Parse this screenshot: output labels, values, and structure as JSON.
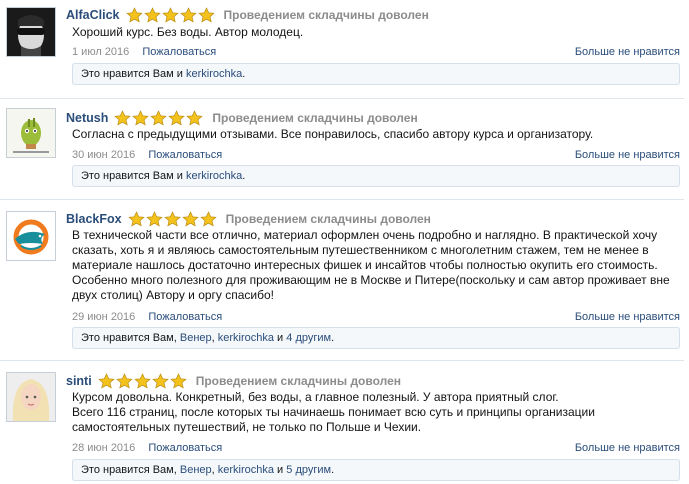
{
  "colors": {
    "link": "#2a4d7a",
    "muted": "#8c8c8c",
    "star": "#f3c21c",
    "like_box_bg": "#f5f8fb"
  },
  "reviews": [
    {
      "author": "AlfaClick",
      "rating": 5,
      "verdict": "Проведением складчины доволен",
      "text": [
        "Хороший курс. Без воды. Автор молодец."
      ],
      "date": "1 июл 2016",
      "report_label": "Пожаловаться",
      "dislike_label": "Больше не нравится",
      "likes": {
        "prefix": "Это нравится Вам и ",
        "users": [
          "kerkirochka"
        ],
        "suffix": "."
      }
    },
    {
      "author": "Netush",
      "rating": 5,
      "verdict": "Проведением складчины доволен",
      "text": [
        "Согласна с предыдущими отзывами. Все понравилось, спасибо автору курса и организатору."
      ],
      "date": "30 июн 2016",
      "report_label": "Пожаловаться",
      "dislike_label": "Больше не нравится",
      "likes": {
        "prefix": "Это нравится Вам и ",
        "users": [
          "kerkirochka"
        ],
        "suffix": "."
      }
    },
    {
      "author": "BlackFox",
      "rating": 5,
      "verdict": "Проведением складчины доволен",
      "text": [
        "В технической части все отлично, материал оформлен очень подробно и наглядно. В практической хочу",
        "сказать, хоть я и являюсь самостоятельным путешественником с многолетним стажем, тем не менее в",
        "материале нашлось достаточно интересных фишек и инсайтов чтобы полностью окупить его стоимость.",
        "Особенно много полезного для проживающим не в Москве и Питере(поскольку и сам автор проживает вне",
        "двух столиц) Автору и оргу спасибо!"
      ],
      "date": "29 июн 2016",
      "report_label": "Пожаловаться",
      "dislike_label": "Больше не нравится",
      "likes": {
        "prefix": "Это нравится Вам, ",
        "users": [
          "Венер",
          "kerkirochka"
        ],
        "others": "4 другим",
        "suffix": "."
      }
    },
    {
      "author": "sinti",
      "rating": 5,
      "verdict": "Проведением складчины доволен",
      "text": [
        "Курсом довольна. Конкретный, без воды, а главное полезный. У автора приятный слог.",
        "Всего 116 страниц, после которых ты начинаешь понимает всю суть и принципы организации",
        "самостоятельных путешествий, не только по Польше и Чехии."
      ],
      "date": "28 июн 2016",
      "report_label": "Пожаловаться",
      "dislike_label": "Больше не нравится",
      "likes": {
        "prefix": "Это нравится Вам, ",
        "users": [
          "Венер",
          "kerkirochka"
        ],
        "others": "5 другим",
        "suffix": "."
      }
    }
  ]
}
